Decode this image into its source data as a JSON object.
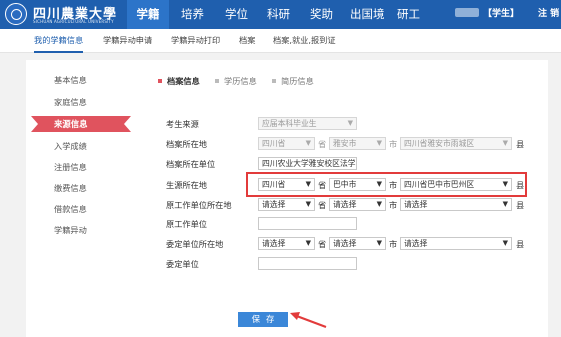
{
  "top_nav": {
    "logo_cn": "四川農業大學",
    "logo_en": "SICHUAN AGRICULTURAL UNIVERSITY",
    "items": [
      "学籍",
      "培养",
      "学位",
      "科研",
      "奖助",
      "出国境",
      "研工"
    ],
    "user_role": "【学生】",
    "logout": "注 销"
  },
  "sub_nav": [
    "我的学籍信息",
    "学籍异动申请",
    "学籍异动打印",
    "档案",
    "档案,就业,报到证"
  ],
  "sidebar": [
    "基本信息",
    "家庭信息",
    "来源信息",
    "入学成绩",
    "注册信息",
    "缴费信息",
    "借款信息",
    "学籍异动"
  ],
  "sidebar_active": "来源信息",
  "tabs": [
    "档案信息",
    "学历信息",
    "简历信息"
  ],
  "form": {
    "labels": {
      "source": "考生来源",
      "archive_loc": "档案所在地",
      "archive_unit": "档案所在单位",
      "origin_loc": "生源所在地",
      "orig_work_loc": "原工作单位所在地",
      "orig_work_unit": "原工作单位",
      "commission_loc": "委定单位所在地",
      "commission_unit": "委定单位"
    },
    "source_value": "应届本科毕业生",
    "archive_loc": {
      "province": "四川省",
      "city": "雅安市",
      "county": "四川省雅安市雨城区"
    },
    "archive_unit_value": "四川农业大学雅安校区法学院",
    "origin_loc": {
      "province": "四川省",
      "city": "巴中市",
      "county": "四川省巴中市巴州区"
    },
    "select_placeholder": "请选择",
    "unit_province": "省",
    "unit_city": "市",
    "unit_county": "县"
  },
  "save_label": "保存",
  "colors": {
    "nav_blue": "#1f5fae",
    "accent_red": "#e0535e",
    "highlight": "#e23b3b",
    "button_blue": "#3b87d8"
  }
}
